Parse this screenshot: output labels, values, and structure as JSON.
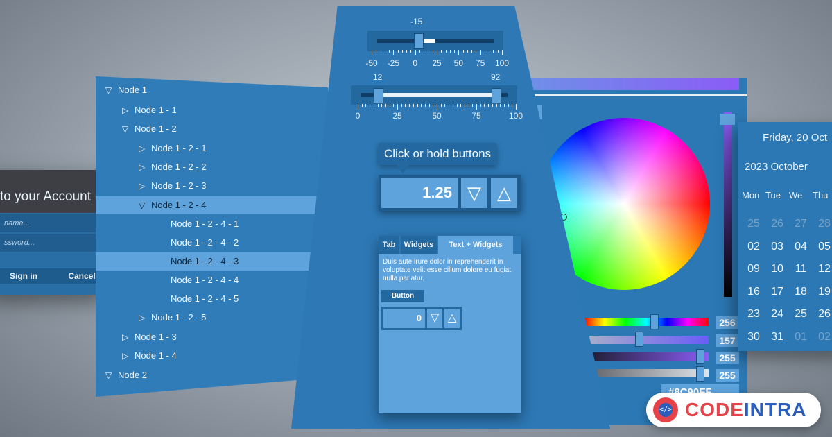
{
  "login": {
    "title": "to your Account",
    "username_placeholder": "name...",
    "password_placeholder": "ssword...",
    "signin_label": "Sign in",
    "cancel_label": "Cancel"
  },
  "tree": {
    "nodes": [
      {
        "label": "Node 1",
        "expanded": true
      },
      {
        "label": "Node 1 - 1",
        "expanded": false
      },
      {
        "label": "Node 1 - 2",
        "expanded": true
      },
      {
        "label": "Node 1 - 2 - 1",
        "expanded": false
      },
      {
        "label": "Node 1 - 2 - 2",
        "expanded": false
      },
      {
        "label": "Node 1 - 2 - 3",
        "expanded": false
      },
      {
        "label": "Node 1 - 2 - 4",
        "expanded": true,
        "selected": true
      },
      {
        "label": "Node 1 - 2 - 4 - 1"
      },
      {
        "label": "Node 1 - 2 - 4 - 2"
      },
      {
        "label": "Node 1 - 2 - 4 - 3",
        "selected": true
      },
      {
        "label": "Node 1 - 2 - 4 - 4"
      },
      {
        "label": "Node 1 - 2 - 4 - 5"
      },
      {
        "label": "Node 1 - 2 - 5",
        "expanded": false
      },
      {
        "label": "Node 1 - 3",
        "expanded": false
      },
      {
        "label": "Node 1 - 4",
        "expanded": false
      },
      {
        "label": "Node 2",
        "expanded": true
      }
    ]
  },
  "slider1": {
    "value_label": "-15",
    "value": -15,
    "min": -50,
    "max": 100,
    "ticks": [
      "-50",
      "-25",
      "0",
      "25",
      "50",
      "75",
      "100"
    ]
  },
  "slider2": {
    "low_label": "12",
    "high_label": "92",
    "low": 12,
    "high": 92,
    "min": 0,
    "max": 100,
    "ticks": [
      "0",
      "25",
      "50",
      "75",
      "100"
    ]
  },
  "tooltip": {
    "text": "Click or hold buttons"
  },
  "stepper_main": {
    "value": "1.25",
    "down_icon": "triangle-down-icon",
    "up_icon": "triangle-up-icon"
  },
  "tabs": {
    "items": [
      "Tab",
      "Widgets",
      "Text + Widgets"
    ],
    "active_index": 2,
    "body_text": "Duis aute irure dolor in reprehenderit in voluptate velit esse cillum dolore eu fugiat nulla pariatur.",
    "button_label": "Button",
    "stepper_value": "0"
  },
  "color": {
    "values": [
      "256",
      "157",
      "255",
      "255"
    ],
    "hex_partial": "#8C90FF",
    "accent": "#8b5cf6"
  },
  "calendar": {
    "date_title": "Friday, 20 Oct",
    "month_title": "2023 October",
    "weekdays": [
      "Mon",
      "Tue",
      "We",
      "Thu"
    ],
    "rows": [
      [
        "25",
        "26",
        "27",
        "28"
      ],
      [
        "02",
        "03",
        "04",
        "05"
      ],
      [
        "09",
        "10",
        "11",
        "12"
      ],
      [
        "16",
        "17",
        "18",
        "19"
      ],
      [
        "23",
        "24",
        "25",
        "26"
      ],
      [
        "30",
        "31",
        "01",
        "02"
      ]
    ],
    "dim_cells": [
      [
        0,
        0
      ],
      [
        0,
        1
      ],
      [
        0,
        2
      ],
      [
        0,
        3
      ],
      [
        5,
        2
      ],
      [
        5,
        3
      ]
    ]
  },
  "logo": {
    "text": "CODEINTRA"
  }
}
